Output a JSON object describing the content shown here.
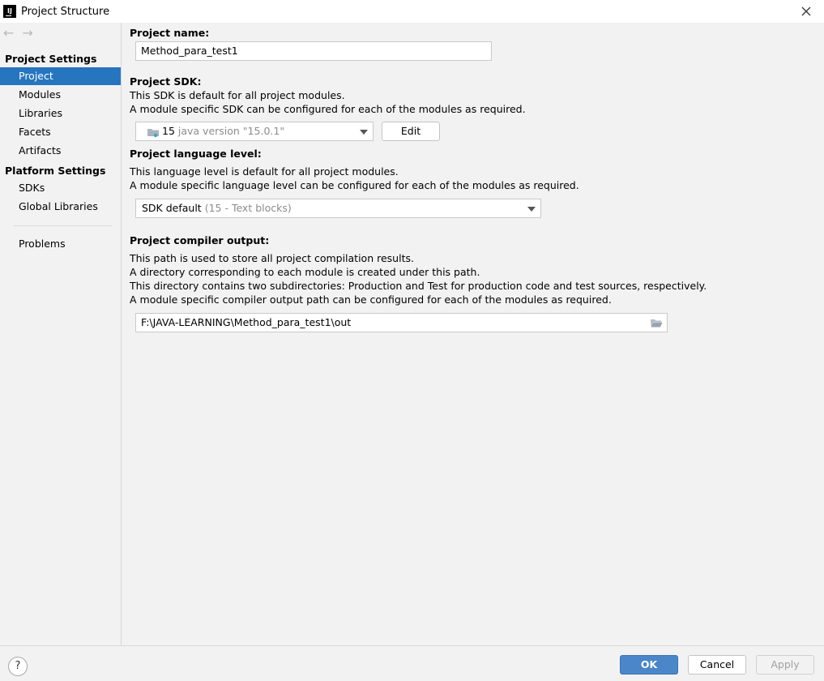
{
  "window": {
    "title": "Project Structure",
    "app_icon_text": "IJ"
  },
  "sidebar": {
    "nav": {
      "back": "←",
      "forward": "→"
    },
    "section_project_settings": "Project Settings",
    "items_project": [
      {
        "label": "Project",
        "selected": true
      },
      {
        "label": "Modules"
      },
      {
        "label": "Libraries"
      },
      {
        "label": "Facets"
      },
      {
        "label": "Artifacts"
      }
    ],
    "section_platform_settings": "Platform Settings",
    "items_platform": [
      {
        "label": "SDKs"
      },
      {
        "label": "Global Libraries"
      }
    ],
    "problems": "Problems"
  },
  "main": {
    "project_name": {
      "label": "Project name:",
      "value": "Method_para_test1"
    },
    "project_sdk": {
      "label": "Project SDK:",
      "desc_line1": "This SDK is default for all project modules.",
      "desc_line2": "A module specific SDK can be configured for each of the modules as required.",
      "selected_version": "15",
      "selected_detail": "java version \"15.0.1\"",
      "edit_label": "Edit"
    },
    "language_level": {
      "label": "Project language level:",
      "desc_line1": "This language level is default for all project modules.",
      "desc_line2": "A module specific language level can be configured for each of the modules as required.",
      "selected": "SDK default",
      "selected_detail": "(15 - Text blocks)"
    },
    "compiler_output": {
      "label": "Project compiler output:",
      "desc_line1": "This path is used to store all project compilation results.",
      "desc_line2": "A directory corresponding to each module is created under this path.",
      "desc_line3": "This directory contains two subdirectories: Production and Test for production code and test sources, respectively.",
      "desc_line4": "A module specific compiler output path can be configured for each of the modules as required.",
      "value": "F:\\JAVA-LEARNING\\Method_para_test1\\out"
    }
  },
  "footer": {
    "help": "?",
    "ok": "OK",
    "cancel": "Cancel",
    "apply": "Apply"
  }
}
